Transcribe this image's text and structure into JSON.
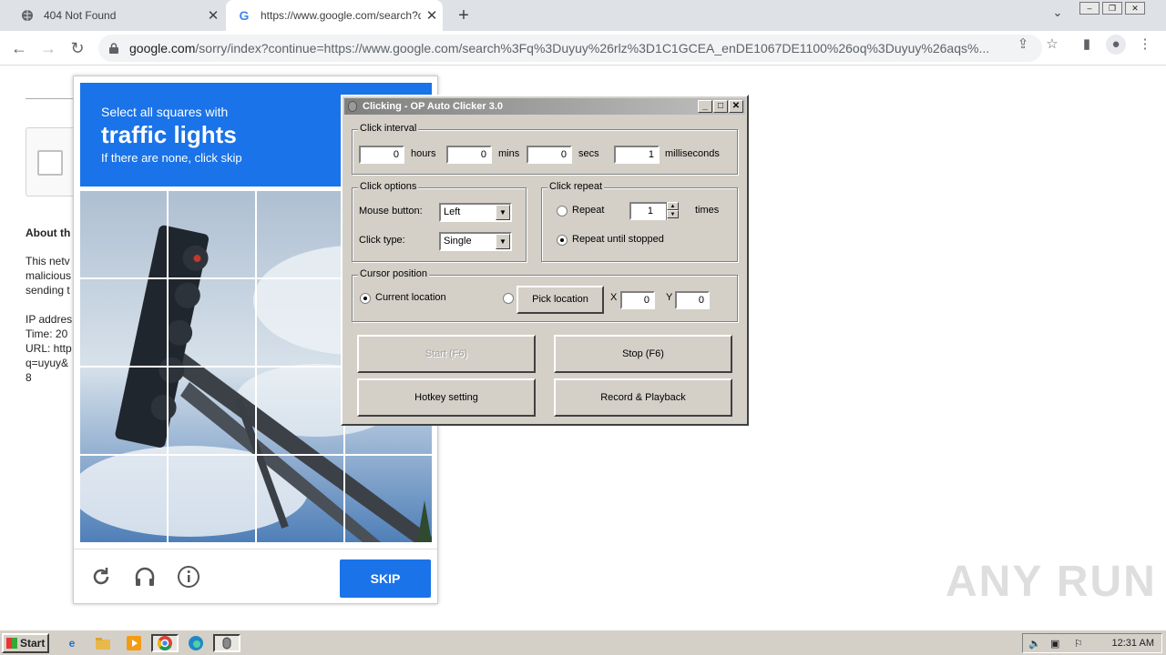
{
  "browser": {
    "tabs": [
      {
        "title": "404 Not Found",
        "icon": "globe-icon"
      },
      {
        "title": "https://www.google.com/search?q=",
        "icon": "google-g-icon"
      }
    ],
    "new_tab": "+",
    "address": {
      "host": "google.com",
      "path": "/sorry/index?continue=https://www.google.com/search%3Fq%3Duyuy%26rlz%3D1C1GCEA_enDE1067DE1100%26oq%3Duyuy%26aqs%..."
    }
  },
  "page": {
    "about": "About th",
    "lines": [
      "This netv",
      "malicious",
      "sending t",
      "",
      "IP addres",
      "Time: 20",
      "URL: http",
      "q=uyuy&",
      "8"
    ]
  },
  "captcha": {
    "line1": "Select all squares with",
    "line2": "traffic lights",
    "line3": "If there are none, click skip",
    "skip_label": "SKIP"
  },
  "clicker": {
    "title": "Clicking - OP Auto Clicker 3.0",
    "interval_label": "Click interval",
    "hours_value": "0",
    "hours_label": "hours",
    "mins_value": "0",
    "mins_label": "mins",
    "secs_value": "0",
    "secs_label": "secs",
    "ms_value": "1",
    "ms_label": "milliseconds",
    "options_label": "Click options",
    "mouse_button_label": "Mouse button:",
    "mouse_button_value": "Left",
    "click_type_label": "Click type:",
    "click_type_value": "Single",
    "repeat_label": "Click repeat",
    "repeat_option": "Repeat",
    "repeat_count": "1",
    "times_label": "times",
    "repeat_until_stopped": "Repeat until stopped",
    "cursor_label": "Cursor position",
    "current_location": "Current location",
    "pick_location": "Pick location",
    "x_label": "X",
    "x_value": "0",
    "y_label": "Y",
    "y_value": "0",
    "start_label": "Start (F6)",
    "stop_label": "Stop (F6)",
    "hotkey_label": "Hotkey setting",
    "record_label": "Record & Playback"
  },
  "watermark": "ANY RUN",
  "taskbar": {
    "start_label": "Start",
    "clock": "12:31 AM"
  },
  "colors": {
    "captcha_blue": "#1a73e8",
    "win_face": "#d4d0c8"
  }
}
